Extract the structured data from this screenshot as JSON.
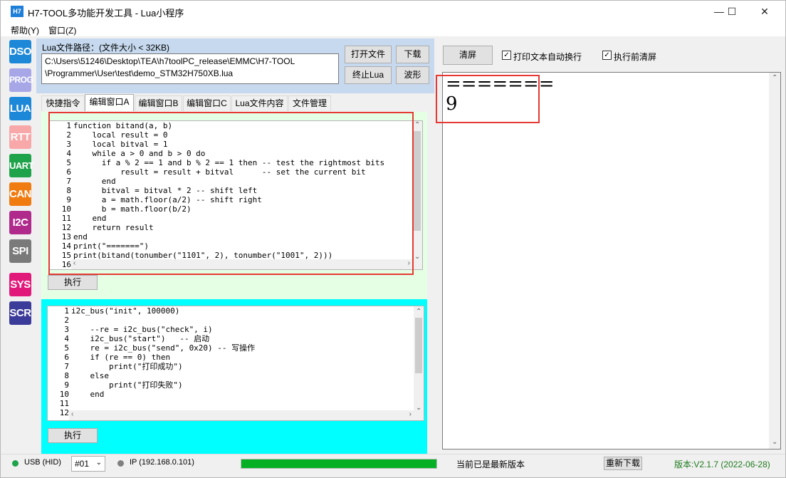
{
  "window": {
    "title": "H7-TOOL多功能开发工具 - Lua小程序",
    "icon_text": "H7",
    "controls": [
      "—",
      "☐",
      "✕"
    ]
  },
  "menu": [
    "帮助(Y)",
    "窗口(Z)"
  ],
  "toolbar": [
    {
      "label": "DSO",
      "color": "#1e88d8"
    },
    {
      "label": "PROG",
      "color": "#a7a7e8"
    },
    {
      "label": "LUA",
      "color": "#1e88d8"
    },
    {
      "label": "RTT",
      "color": "#f8a8a8"
    },
    {
      "label": "UART",
      "color": "#1ea24a"
    },
    {
      "label": "CAN",
      "color": "#f07b10"
    },
    {
      "label": "I2C",
      "color": "#b02a8c"
    },
    {
      "label": "SPI",
      "color": "#7a7a7a"
    },
    {
      "label": "SYS",
      "color": "#e0197a"
    },
    {
      "label": "SCR",
      "color": "#3b3b9a"
    }
  ],
  "lua_file": {
    "path_label": "Lua文件路径：(文件大小 < 32KB)",
    "path_line1": "C:\\Users\\51246\\Desktop\\TEA\\h7toolPC_release\\EMMC\\H7-TOOL",
    "path_line2": "\\Programmer\\User\\test\\demo_STM32H750XB.lua",
    "open_button": "打开文件",
    "download_button": "下载",
    "stop_button": "终止Lua",
    "wave_button": "波形"
  },
  "tabs": [
    "快捷指令",
    "编辑窗口A",
    "编辑窗口B",
    "编辑窗口C",
    "Lua文件内容",
    "文件管理"
  ],
  "active_tab": 1,
  "editor_a": {
    "lines": [
      "function bitand(a, b)",
      "    local result = 0",
      "    local bitval = 1",
      "    while a > 0 and b > 0 do",
      "      if a % 2 == 1 and b % 2 == 1 then -- test the rightmost bits",
      "          result = result + bitval      -- set the current bit",
      "      end",
      "      bitval = bitval * 2 -- shift left",
      "      a = math.floor(a/2) -- shift right",
      "      b = math.floor(b/2)",
      "    end",
      "    return result",
      "end",
      "print(\"=======\")",
      "print(bitand(tonumber(\"1101\", 2), tonumber(\"1001\", 2)))",
      ""
    ],
    "run_button": "执行"
  },
  "editor_b": {
    "lines": [
      "i2c_bus(\"init\", 100000)",
      "",
      "    --re = i2c_bus(\"check\", i)",
      "    i2c_bus(\"start\")   -- 启动",
      "    re = i2c_bus(\"send\", 0x20) -- 写操作",
      "    if (re == 0) then",
      "        print(\"打印成功\")",
      "    else",
      "        print(\"打印失败\")",
      "    end",
      "",
      ""
    ],
    "run_button": "执行"
  },
  "output": {
    "clear_button": "清屏",
    "auto_wrap_label": "打印文本自动换行",
    "auto_wrap_checked": true,
    "clear_before_run_label": "执行前清屏",
    "clear_before_run_checked": true,
    "text_line1": "=======",
    "text_line2": "9"
  },
  "status": {
    "usb_label": "USB (HID)",
    "usb_color": "#1ea24a",
    "device_select": "#01",
    "ip_label": "IP (192.168.0.101)",
    "ip_color": "#808080",
    "progress": 1.0,
    "version_msg": "当前已是最新版本",
    "redownload_button": "重新下载",
    "version": "版本:V2.1.7 (2022-06-28)",
    "version_color": "#1e7a1e"
  },
  "accent_red": "#e53935"
}
